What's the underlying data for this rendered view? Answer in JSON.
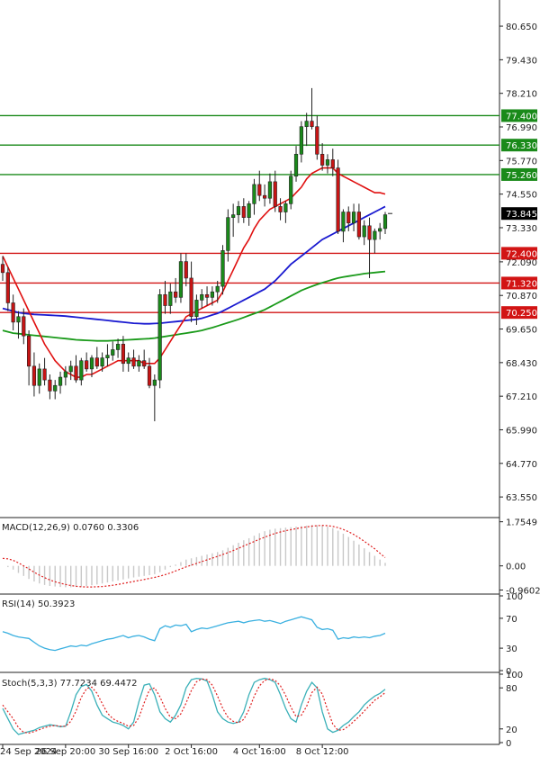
{
  "chart_data": {
    "type": "candlestick",
    "main": {
      "y_ticks": [
        "80.650",
        "79.430",
        "78.210",
        "76.990",
        "75.770",
        "74.550",
        "73.330",
        "72.090",
        "70.870",
        "69.650",
        "68.430",
        "67.210",
        "65.990",
        "64.770",
        "63.550"
      ],
      "ylim": [
        62.9,
        81.6
      ],
      "current_price": "73.845",
      "horizontal_levels": [
        {
          "value": "77.400",
          "color": "#1a8a1a"
        },
        {
          "value": "76.330",
          "color": "#1a8a1a"
        },
        {
          "value": "75.260",
          "color": "#1a8a1a"
        },
        {
          "value": "72.400",
          "color": "#d21414"
        },
        {
          "value": "71.320",
          "color": "#d21414"
        },
        {
          "value": "70.250",
          "color": "#d21414"
        }
      ],
      "candles": [
        [
          72.0,
          72.3,
          71.4,
          71.7
        ],
        [
          71.7,
          71.9,
          70.3,
          70.6
        ],
        [
          70.6,
          70.9,
          69.6,
          69.9
        ],
        [
          69.9,
          70.3,
          69.3,
          70.1
        ],
        [
          70.1,
          70.4,
          69.1,
          69.4
        ],
        [
          69.4,
          69.6,
          67.6,
          68.3
        ],
        [
          68.3,
          68.8,
          67.2,
          67.6
        ],
        [
          67.6,
          68.4,
          67.3,
          68.2
        ],
        [
          68.2,
          68.6,
          67.6,
          67.8
        ],
        [
          67.8,
          68.0,
          67.1,
          67.4
        ],
        [
          67.4,
          67.8,
          67.1,
          67.6
        ],
        [
          67.6,
          68.1,
          67.3,
          67.9
        ],
        [
          67.9,
          68.3,
          67.6,
          68.1
        ],
        [
          68.1,
          68.5,
          67.8,
          68.3
        ],
        [
          68.3,
          68.7,
          67.7,
          67.8
        ],
        [
          67.8,
          68.6,
          67.6,
          68.5
        ],
        [
          68.5,
          68.8,
          68.1,
          68.2
        ],
        [
          68.2,
          68.7,
          67.9,
          68.6
        ],
        [
          68.6,
          69.0,
          68.2,
          68.3
        ],
        [
          68.3,
          68.8,
          68.1,
          68.6
        ],
        [
          68.6,
          69.1,
          68.3,
          68.7
        ],
        [
          68.7,
          69.2,
          68.5,
          68.9
        ],
        [
          68.9,
          69.3,
          68.6,
          69.1
        ],
        [
          69.1,
          69.4,
          68.1,
          68.4
        ],
        [
          68.4,
          68.8,
          68.1,
          68.6
        ],
        [
          68.6,
          68.9,
          68.2,
          68.3
        ],
        [
          68.3,
          68.7,
          68.1,
          68.5
        ],
        [
          68.5,
          68.9,
          68.2,
          68.3
        ],
        [
          68.3,
          68.6,
          67.5,
          67.6
        ],
        [
          67.6,
          68.0,
          66.3,
          67.8
        ],
        [
          67.8,
          71.1,
          67.5,
          70.9
        ],
        [
          70.9,
          71.4,
          70.2,
          70.5
        ],
        [
          70.5,
          71.3,
          70.2,
          71.0
        ],
        [
          71.0,
          71.5,
          70.6,
          70.8
        ],
        [
          70.8,
          72.4,
          70.6,
          72.1
        ],
        [
          72.1,
          72.4,
          71.2,
          71.5
        ],
        [
          71.5,
          72.1,
          69.9,
          70.1
        ],
        [
          70.1,
          70.9,
          69.8,
          70.7
        ],
        [
          70.7,
          71.1,
          70.4,
          70.9
        ],
        [
          70.9,
          71.2,
          70.5,
          70.8
        ],
        [
          70.8,
          71.2,
          70.5,
          71.0
        ],
        [
          71.0,
          71.4,
          70.6,
          71.2
        ],
        [
          71.2,
          72.7,
          70.9,
          72.5
        ],
        [
          72.5,
          74.0,
          72.1,
          73.7
        ],
        [
          73.7,
          74.2,
          73.0,
          73.8
        ],
        [
          73.8,
          74.3,
          73.5,
          74.1
        ],
        [
          74.1,
          74.4,
          73.5,
          73.7
        ],
        [
          73.7,
          74.3,
          73.4,
          74.2
        ],
        [
          74.2,
          75.1,
          73.8,
          74.9
        ],
        [
          74.9,
          75.4,
          74.3,
          74.5
        ],
        [
          74.5,
          74.9,
          74.1,
          74.4
        ],
        [
          74.4,
          75.3,
          74.2,
          75.0
        ],
        [
          75.0,
          75.4,
          73.9,
          74.1
        ],
        [
          74.1,
          74.4,
          73.6,
          73.9
        ],
        [
          73.9,
          74.3,
          73.5,
          74.2
        ],
        [
          74.2,
          75.4,
          74.0,
          75.2
        ],
        [
          75.2,
          76.3,
          75.0,
          76.0
        ],
        [
          76.0,
          77.2,
          75.7,
          77.0
        ],
        [
          77.0,
          77.5,
          76.3,
          77.2
        ],
        [
          77.2,
          78.4,
          76.9,
          77.0
        ],
        [
          77.0,
          77.4,
          75.8,
          76.0
        ],
        [
          76.0,
          76.4,
          75.4,
          75.6
        ],
        [
          75.6,
          76.0,
          75.3,
          75.8
        ],
        [
          75.8,
          76.2,
          75.2,
          75.5
        ],
        [
          75.5,
          75.8,
          73.1,
          73.2
        ],
        [
          73.2,
          74.0,
          72.8,
          73.9
        ],
        [
          73.9,
          74.1,
          73.2,
          73.5
        ],
        [
          73.5,
          74.2,
          73.2,
          73.9
        ],
        [
          73.9,
          74.2,
          72.9,
          73.0
        ],
        [
          73.0,
          73.6,
          72.7,
          73.4
        ],
        [
          73.4,
          73.7,
          71.5,
          72.9
        ],
        [
          72.9,
          73.3,
          72.4,
          73.2
        ],
        [
          73.2,
          73.5,
          72.9,
          73.3
        ],
        [
          73.3,
          73.9,
          73.1,
          73.8
        ]
      ],
      "ma_fast": [
        72.3,
        71.9,
        71.5,
        71.1,
        70.7,
        70.3,
        69.9,
        69.5,
        69.1,
        68.8,
        68.5,
        68.3,
        68.1,
        68.0,
        67.9,
        67.9,
        68.0,
        68.0,
        68.1,
        68.2,
        68.3,
        68.4,
        68.5,
        68.5,
        68.5,
        68.5,
        68.5,
        68.4,
        68.4,
        68.4,
        68.6,
        68.9,
        69.2,
        69.5,
        69.8,
        70.1,
        70.2,
        70.3,
        70.4,
        70.5,
        70.6,
        70.7,
        71.0,
        71.4,
        71.8,
        72.2,
        72.6,
        72.9,
        73.3,
        73.6,
        73.8,
        74.0,
        74.1,
        74.2,
        74.3,
        74.4,
        74.6,
        74.8,
        75.1,
        75.3,
        75.4,
        75.5,
        75.5,
        75.5,
        75.3,
        75.2,
        75.1,
        75.0,
        74.9,
        74.8,
        74.7,
        74.6,
        74.6,
        74.55
      ],
      "ma_mid": [
        70.4,
        70.35,
        70.3,
        70.25,
        70.22,
        70.2,
        70.18,
        70.17,
        70.16,
        70.15,
        70.14,
        70.13,
        70.12,
        70.1,
        70.08,
        70.06,
        70.04,
        70.02,
        70.0,
        69.98,
        69.96,
        69.94,
        69.92,
        69.9,
        69.88,
        69.86,
        69.85,
        69.84,
        69.84,
        69.85,
        69.86,
        69.88,
        69.9,
        69.92,
        69.94,
        69.96,
        69.98,
        70.0,
        70.04,
        70.1,
        70.16,
        70.22,
        70.3,
        70.4,
        70.5,
        70.6,
        70.7,
        70.8,
        70.9,
        71.0,
        71.1,
        71.25,
        71.4,
        71.6,
        71.8,
        72.0,
        72.15,
        72.3,
        72.45,
        72.6,
        72.75,
        72.9,
        73.0,
        73.1,
        73.2,
        73.3,
        73.4,
        73.5,
        73.6,
        73.7,
        73.8,
        73.9,
        74.0,
        74.1
      ],
      "ma_slow": [
        69.6,
        69.55,
        69.5,
        69.48,
        69.46,
        69.44,
        69.42,
        69.4,
        69.38,
        69.36,
        69.34,
        69.32,
        69.3,
        69.28,
        69.26,
        69.25,
        69.24,
        69.23,
        69.22,
        69.22,
        69.22,
        69.23,
        69.24,
        69.25,
        69.26,
        69.27,
        69.28,
        69.29,
        69.3,
        69.32,
        69.35,
        69.38,
        69.41,
        69.44,
        69.47,
        69.5,
        69.53,
        69.56,
        69.6,
        69.65,
        69.7,
        69.76,
        69.82,
        69.88,
        69.94,
        70.0,
        70.07,
        70.14,
        70.21,
        70.28,
        70.35,
        70.45,
        70.55,
        70.65,
        70.75,
        70.85,
        70.95,
        71.05,
        71.13,
        71.2,
        71.27,
        71.33,
        71.39,
        71.45,
        71.5,
        71.54,
        71.57,
        71.6,
        71.63,
        71.66,
        71.68,
        71.7,
        71.72,
        71.74
      ]
    },
    "macd": {
      "label": "MACD(12,26,9) 0.0760 0.3306",
      "y_ticks": [
        "1.7549",
        "0.00",
        "-0.9602"
      ],
      "ylim": [
        -1.05,
        1.85
      ],
      "histogram": [
        0.0,
        -0.05,
        -0.15,
        -0.28,
        -0.4,
        -0.52,
        -0.62,
        -0.7,
        -0.76,
        -0.8,
        -0.82,
        -0.84,
        -0.85,
        -0.85,
        -0.84,
        -0.82,
        -0.8,
        -0.77,
        -0.74,
        -0.7,
        -0.66,
        -0.62,
        -0.58,
        -0.54,
        -0.5,
        -0.46,
        -0.43,
        -0.4,
        -0.37,
        -0.33,
        -0.25,
        -0.15,
        -0.05,
        0.05,
        0.15,
        0.25,
        0.3,
        0.35,
        0.4,
        0.45,
        0.5,
        0.55,
        0.62,
        0.72,
        0.82,
        0.92,
        1.02,
        1.1,
        1.2,
        1.3,
        1.38,
        1.44,
        1.48,
        1.5,
        1.52,
        1.54,
        1.56,
        1.58,
        1.6,
        1.62,
        1.62,
        1.6,
        1.56,
        1.5,
        1.4,
        1.28,
        1.15,
        1.0,
        0.85,
        0.7,
        0.55,
        0.4,
        0.25,
        0.12
      ],
      "signal": [
        0.3,
        0.28,
        0.22,
        0.12,
        0.0,
        -0.12,
        -0.25,
        -0.37,
        -0.47,
        -0.56,
        -0.63,
        -0.69,
        -0.74,
        -0.78,
        -0.81,
        -0.83,
        -0.84,
        -0.84,
        -0.83,
        -0.82,
        -0.8,
        -0.77,
        -0.74,
        -0.7,
        -0.66,
        -0.62,
        -0.58,
        -0.54,
        -0.5,
        -0.46,
        -0.41,
        -0.35,
        -0.28,
        -0.2,
        -0.12,
        -0.04,
        0.03,
        0.1,
        0.17,
        0.24,
        0.31,
        0.38,
        0.45,
        0.53,
        0.61,
        0.7,
        0.79,
        0.88,
        0.97,
        1.06,
        1.14,
        1.22,
        1.29,
        1.35,
        1.4,
        1.44,
        1.48,
        1.52,
        1.55,
        1.58,
        1.6,
        1.61,
        1.6,
        1.57,
        1.52,
        1.45,
        1.36,
        1.25,
        1.12,
        0.98,
        0.83,
        0.68,
        0.5,
        0.33
      ]
    },
    "rsi": {
      "label": "RSI(14) 50.3923",
      "y_ticks": [
        "100",
        "70",
        "30",
        "0"
      ],
      "ylim": [
        0,
        100
      ],
      "values": [
        52,
        50,
        47,
        45,
        44,
        43,
        38,
        33,
        30,
        28,
        27,
        29,
        31,
        33,
        32,
        34,
        33,
        36,
        38,
        40,
        42,
        43,
        45,
        47,
        44,
        46,
        47,
        45,
        42,
        40,
        56,
        60,
        58,
        61,
        60,
        62,
        52,
        55,
        57,
        56,
        58,
        60,
        62,
        64,
        65,
        66,
        64,
        66,
        67,
        68,
        66,
        67,
        65,
        63,
        66,
        68,
        70,
        72,
        70,
        68,
        58,
        55,
        56,
        54,
        42,
        44,
        43,
        45,
        44,
        45,
        44,
        46,
        47,
        50
      ]
    },
    "stoch": {
      "label": "Stoch(5,3,3) 77.7234 69.4472",
      "y_ticks": [
        "100",
        "80",
        "20",
        "0"
      ],
      "ylim": [
        0,
        100
      ],
      "k": [
        50,
        35,
        20,
        12,
        14,
        16,
        18,
        22,
        24,
        26,
        25,
        23,
        24,
        45,
        70,
        82,
        85,
        75,
        55,
        40,
        35,
        30,
        28,
        25,
        20,
        30,
        60,
        84,
        86,
        70,
        45,
        35,
        30,
        40,
        55,
        80,
        92,
        94,
        93,
        90,
        70,
        45,
        35,
        30,
        28,
        30,
        45,
        70,
        88,
        92,
        94,
        92,
        88,
        70,
        50,
        35,
        30,
        55,
        75,
        88,
        80,
        45,
        20,
        15,
        18,
        25,
        30,
        38,
        45,
        55,
        62,
        68,
        72,
        78
      ],
      "d": [
        55,
        45,
        35,
        22,
        15,
        14,
        16,
        19,
        22,
        24,
        25,
        24,
        24,
        31,
        46,
        66,
        79,
        81,
        72,
        57,
        43,
        35,
        31,
        28,
        24,
        25,
        37,
        58,
        77,
        80,
        67,
        50,
        37,
        35,
        42,
        58,
        76,
        89,
        93,
        92,
        84,
        68,
        50,
        37,
        31,
        29,
        34,
        48,
        68,
        83,
        91,
        93,
        91,
        83,
        69,
        52,
        38,
        40,
        53,
        73,
        81,
        71,
        48,
        27,
        18,
        19,
        24,
        31,
        38,
        46,
        54,
        62,
        67,
        73
      ]
    },
    "x_labels": [
      "24 Sep 2024",
      "26 Sep 20:00",
      "30 Sep 16:00",
      "2 Oct 16:00",
      "4 Oct 16:00",
      "8 Oct 12:00"
    ],
    "colors": {
      "up": "#1a8a1a",
      "down": "#c81414",
      "ma_fast": "#e01010",
      "ma_mid": "#1a1ad0",
      "ma_slow": "#1a9a1a",
      "signal": "#e02020",
      "hist": "#c8c8c8",
      "rsi": "#3ab0e0",
      "stoch_k": "#3ab0b8",
      "stoch_d": "#e02020",
      "current_tag": "#000000"
    }
  }
}
